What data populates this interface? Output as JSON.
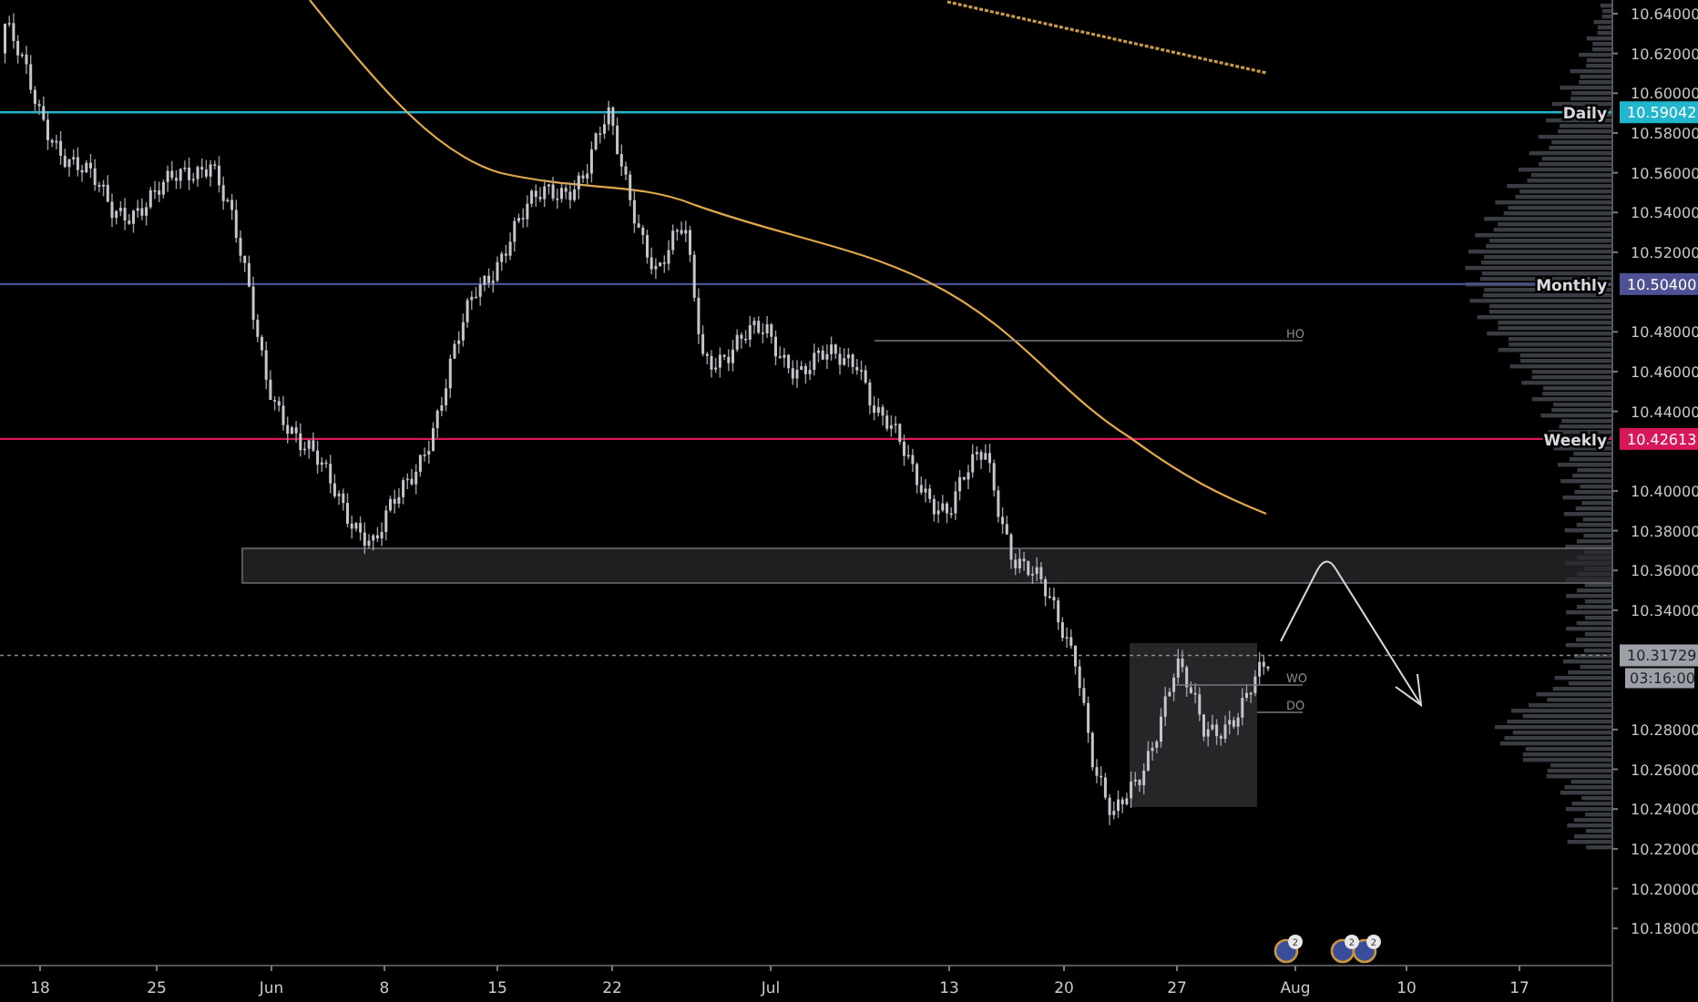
{
  "price_axis": {
    "ticks": [
      "10.64000",
      "10.62000",
      "10.60000",
      "10.58000",
      "10.56000",
      "10.54000",
      "10.52000",
      "10.48000",
      "10.46000",
      "10.44000",
      "10.40000",
      "10.38000",
      "10.36000",
      "10.34000",
      "10.28000",
      "10.26000",
      "10.24000",
      "10.22000",
      "10.20000",
      "10.18000"
    ]
  },
  "time_axis": {
    "ticks": [
      "18",
      "25",
      "Jun",
      "8",
      "15",
      "22",
      "Jul",
      "13",
      "20",
      "27",
      "Aug",
      "10",
      "17"
    ]
  },
  "levels": [
    {
      "label": "Daily",
      "price": "10.59042",
      "color": "#22b5cc"
    },
    {
      "label": "Monthly",
      "price": "10.50400",
      "color": "#4e5294"
    },
    {
      "label": "Weekly",
      "price": "10.42613",
      "color": "#d8175a"
    }
  ],
  "current_price": {
    "price": "10.31729",
    "countdown": "03:16:00"
  },
  "chart_markers": [
    {
      "label": "HO"
    },
    {
      "label": "WO"
    },
    {
      "label": "DO"
    }
  ],
  "events": [
    {
      "count": "2"
    },
    {
      "count": "2"
    },
    {
      "count": "2"
    }
  ]
}
